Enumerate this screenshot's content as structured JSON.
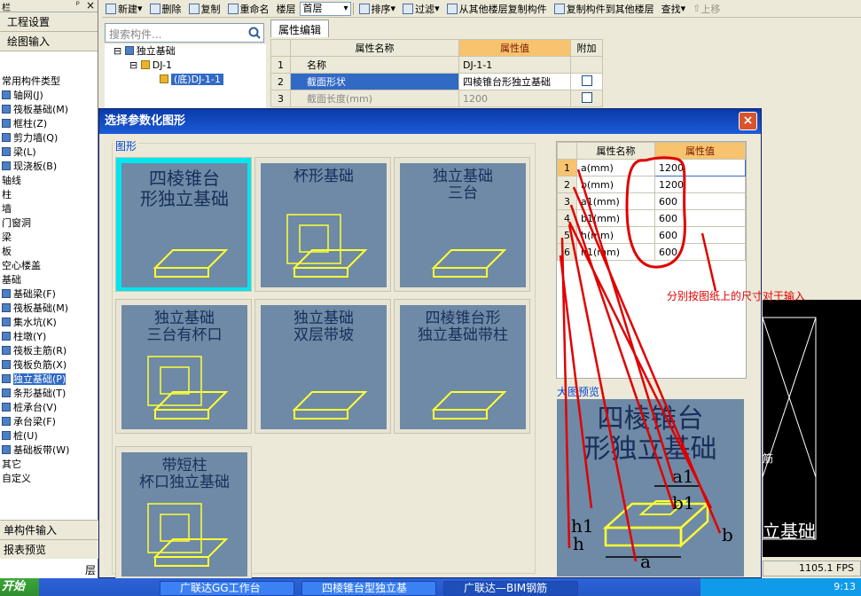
{
  "toolbar": {
    "new": "新建",
    "delete": "删除",
    "copy": "复制",
    "rename": "重命名",
    "floor_label": "楼层",
    "floor_value": "首层",
    "sort": "排序",
    "filter": "过滤",
    "copy_from": "从其他楼层复制构件",
    "copy_to": "复制构件到其他楼层",
    "find": "查找",
    "move_up": "上移"
  },
  "left": {
    "head": "栏",
    "pin": "ᵖ",
    "close": "×",
    "project_settings": "工程设置",
    "drawing_input": "绘图输入",
    "category": "常用构件类型",
    "items": [
      "轴网(J)",
      "筏板基础(M)",
      "框柱(Z)",
      "剪力墙(Q)",
      "梁(L)",
      "现浇板(B)",
      "轴线",
      "柱",
      "墙",
      "门窗洞",
      "梁",
      "板",
      "空心楼盖",
      "基础",
      "基础梁(F)",
      "筏板基础(M)",
      "集水坑(K)",
      "柱墩(Y)",
      "筏板主筋(R)",
      "筏板负筋(X)",
      "独立基础(P)",
      "条形基础(T)",
      "桩承台(V)",
      "承台梁(F)",
      "桩(U)",
      "基础板带(W)",
      "其它",
      "自定义"
    ],
    "single_input": "单构件输入",
    "report_preview": "报表预览"
  },
  "search": {
    "placeholder": "搜索构件..."
  },
  "tree": {
    "root": "独立基础",
    "child": "DJ-1",
    "leaf": "(底)DJ-1-1"
  },
  "props": {
    "tab": "属性编辑",
    "headers": [
      "属性名称",
      "属性值",
      "附加"
    ],
    "rows": [
      {
        "n": "1",
        "name": "名称",
        "value": "DJ-1-1"
      },
      {
        "n": "2",
        "name": "截面形状",
        "value": "四棱锥台形独立基础"
      },
      {
        "n": "3",
        "name": "截面长度(mm)",
        "value": "1200"
      }
    ]
  },
  "dialog": {
    "title": "选择参数化图形",
    "close": "×",
    "group_label": "图形",
    "tiles": [
      {
        "title": "四棱锥台\n形独立基础",
        "selected": true
      },
      {
        "title": "杯形基础",
        "selected": false
      },
      {
        "title": "独立基础\n三台",
        "selected": false
      },
      {
        "title": "独立基础\n三台有杯口",
        "selected": false
      },
      {
        "title": "独立基础\n双层带坡",
        "selected": false
      },
      {
        "title": "四棱锥台形\n独立基础带柱",
        "selected": false
      },
      {
        "title": "带短柱\n杯口独立基础",
        "selected": false
      }
    ],
    "params_headers": [
      "属性名称",
      "属性值"
    ],
    "params": [
      {
        "n": "1",
        "name": "a(mm)",
        "value": "1200"
      },
      {
        "n": "2",
        "name": "b(mm)",
        "value": "1200"
      },
      {
        "n": "3",
        "name": "a1(mm)",
        "value": "600"
      },
      {
        "n": "4",
        "name": "b1(mm)",
        "value": "600"
      },
      {
        "n": "5",
        "name": "h(mm)",
        "value": "600"
      },
      {
        "n": "6",
        "name": "h1(mm)",
        "value": "600"
      }
    ],
    "preview_label": "大图预览",
    "preview_title": "四棱锥台\n形独立基础",
    "annotation": "分别按图纸上的尺寸对于输入"
  },
  "cad": {
    "label1": "筋",
    "label2": "立基础"
  },
  "status": {
    "fps": "1105.1 FPS",
    "layer": "层"
  },
  "taskbar": {
    "start": "开始",
    "tasks": [
      "广联达GG工作台",
      "四棱锥台型独立基",
      "广联达—BIM钢筋"
    ],
    "clock": "9:13"
  },
  "colors": {
    "accent": "#316ac5",
    "orange": "#f7c36e",
    "tile_bg": "#6e8aa6",
    "annot": "#e00000"
  }
}
